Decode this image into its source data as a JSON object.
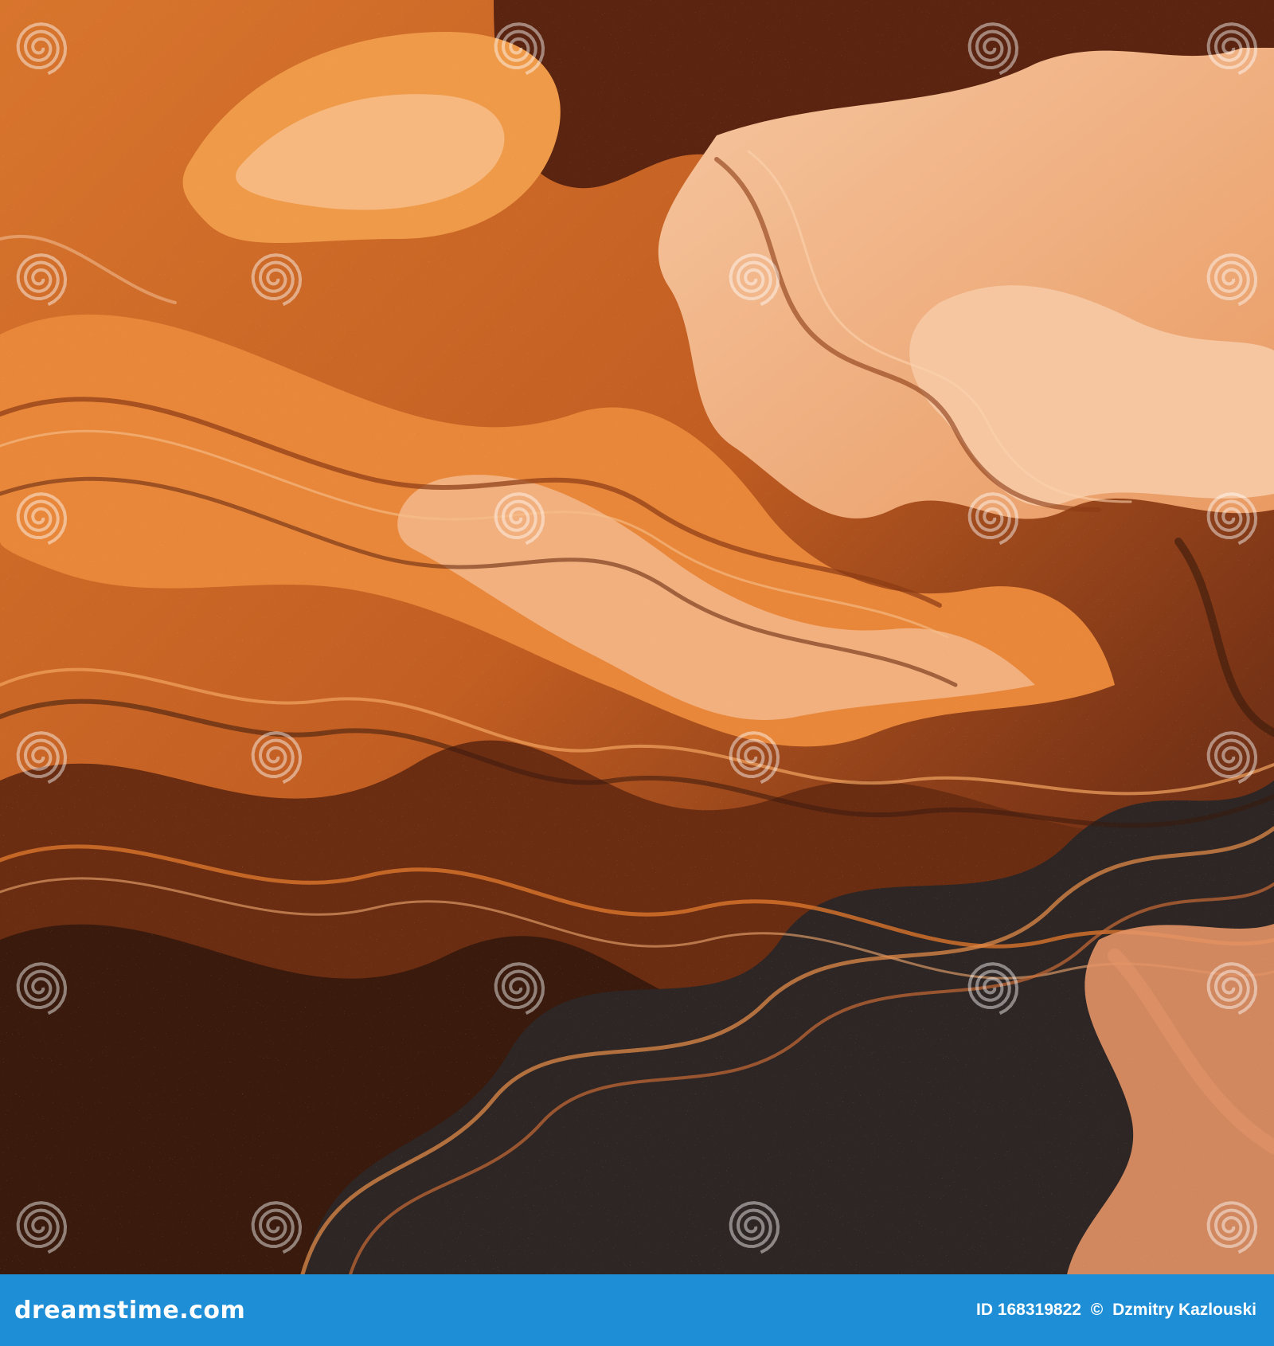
{
  "image": {
    "palette": {
      "deep_brown": "#3a1a0c",
      "dark_brown": "#6a2d12",
      "rust": "#a3451a",
      "burnt_orange": "#d9742c",
      "orange": "#ef9a48",
      "peach": "#f2b07e",
      "light_peach": "#f6c6a0",
      "charcoal": "#2e2624"
    }
  },
  "watermark": {
    "brand": "dreamstime.com",
    "icon_name": "spiral-icon"
  },
  "footer": {
    "brand_text": "dreamstime.com",
    "id_text": "ID 168319822",
    "copyright_symbol": "©",
    "author": "Dzmitry Kazlouski",
    "bar_color": "#1e8fd6"
  }
}
